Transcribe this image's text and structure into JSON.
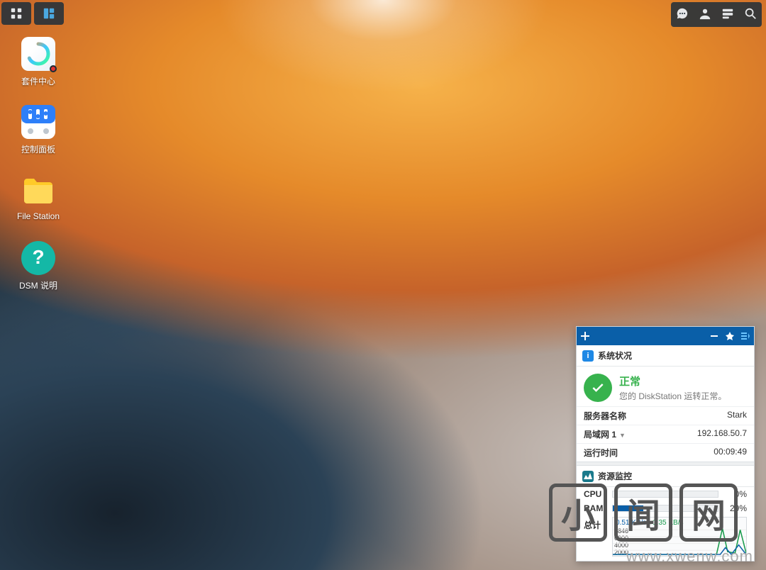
{
  "taskbar": {
    "left_buttons": [
      "apps-grid",
      "dashboard"
    ],
    "right_buttons": [
      "chat",
      "user",
      "widgets",
      "search"
    ]
  },
  "desktop_icons": [
    {
      "id": "package-center",
      "label": "套件中心",
      "has_badge": true
    },
    {
      "id": "control-panel",
      "label": "控制面板"
    },
    {
      "id": "file-station",
      "label": "File Station"
    },
    {
      "id": "dsm-help",
      "label": "DSM 说明"
    }
  ],
  "widget": {
    "system_status": {
      "title": "系统状况",
      "status_label": "正常",
      "status_desc": "您的 DiskStation 运转正常。",
      "rows": [
        {
          "k": "服务器名称",
          "v": "Stark"
        },
        {
          "k": "局域网 1",
          "v": "192.168.50.7",
          "dropdown": true
        },
        {
          "k": "运行时间",
          "v": "00:09:49"
        }
      ]
    },
    "resource_monitor": {
      "title": "资源监控",
      "cpu": {
        "label": "CPU",
        "pct": 0,
        "pct_text": "0%"
      },
      "ram": {
        "label": "RAM",
        "pct": 29,
        "pct_text": "29%"
      },
      "net": {
        "label": "总计",
        "up": "0.51 KB/s",
        "down": "1.35 KB/s",
        "y_ticks": [
          "7846",
          "6000",
          "4000",
          "2000"
        ]
      }
    }
  },
  "watermark": {
    "chars": [
      "小",
      "闻",
      "网"
    ],
    "url": "www.xwenw.com"
  }
}
